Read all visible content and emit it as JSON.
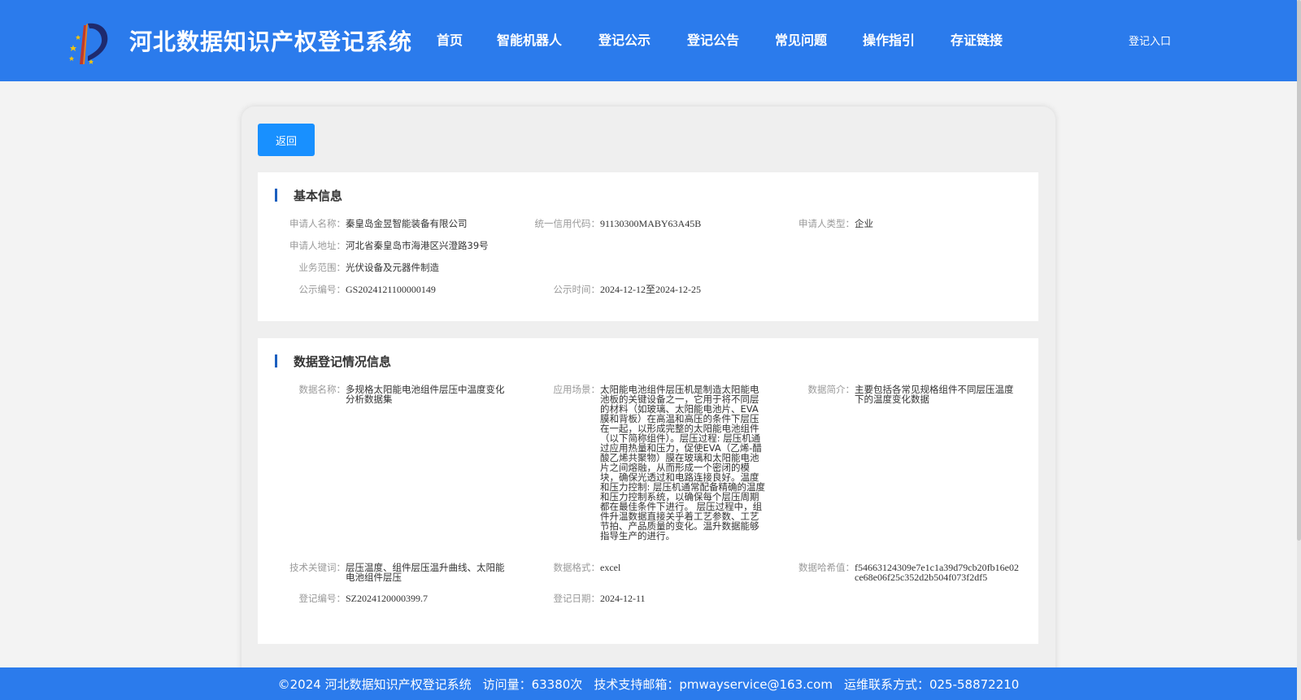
{
  "header": {
    "site_title": "河北数据知识产权登记系统",
    "nav": [
      "首页",
      "智能机器人",
      "登记公示",
      "登记公告",
      "常见问题",
      "操作指引",
      "存证链接"
    ],
    "login": "登记入口",
    "logo_icon": "logo-icon"
  },
  "back_button": "返回",
  "basic_info": {
    "title": "基本信息",
    "applicant_name_label": "申请人名称：",
    "applicant_name": "秦皇岛金昱智能装备有限公司",
    "credit_code_label": "统一信用代码：",
    "credit_code": "91130300MABY63A45B",
    "applicant_type_label": "申请人类型：",
    "applicant_type": "企业",
    "address_label": "申请人地址：",
    "address": "河北省秦皇岛市海港区兴澄路39号",
    "business_scope_label": "业务范围：",
    "business_scope": "光伏设备及元器件制造",
    "notice_no_label": "公示编号：",
    "notice_no": "GS2024121100000149",
    "notice_time_label": "公示时间：",
    "notice_time": "2024-12-12至2024-12-25"
  },
  "registration_info": {
    "title": "数据登记情况信息",
    "data_name_label": "数据名称：",
    "data_name": "多规格太阳能电池组件层压中温度变化分析数据集",
    "scenario_label": "应用场景：",
    "scenario": "太阳能电池组件层压机是制造太阳能电池板的关键设备之一，它用于将不同层的材料（如玻璃、太阳能电池片、EVA膜和背板）在高温和高压的条件下层压在一起，以形成完整的太阳能电池组件（以下简称组件）。层压过程: 层压机通过应用热量和压力，促使EVA（乙烯-醋酸乙烯共聚物）膜在玻璃和太阳能电池片之间熔融，从而形成一个密闭的模块，确保光透过和电路连接良好。温度和压力控制: 层压机通常配备精确的温度和压力控制系统，以确保每个层压周期都在最佳条件下进行。 层压过程中，组件升温数据直接关乎着工艺参数、工艺节拍、产品质量的变化。温升数据能够指导生产的进行。",
    "intro_label": "数据简介：",
    "intro": "主要包括各常见规格组件不同层压温度下的温度变化数据",
    "keywords_label": "技术关键词：",
    "keywords": "层压温度、组件层压温升曲线、太阳能电池组件层压",
    "format_label": "数据格式：",
    "format": "excel",
    "hash_label": "数据哈希值：",
    "hash": "f54663124309e7e1c1a39d79cb20fb16e02ce68e06f25c352d2b504f073f2df5",
    "reg_no_label": "登记编号：",
    "reg_no": "SZ2024120000399.7",
    "reg_date_label": "登记日期：",
    "reg_date": "2024-12-11"
  },
  "footer": {
    "copyright": "©2024 河北数据知识产权登记系统",
    "visits": "访问量：63380次",
    "email": "技术支持邮箱：pmwayservice@163.com",
    "contact": "运维联系方式：025-58872210"
  },
  "colors": {
    "header_bg": "#2b7bec",
    "button_bg": "#1890ff",
    "title_bar": "#1b5fbf"
  }
}
